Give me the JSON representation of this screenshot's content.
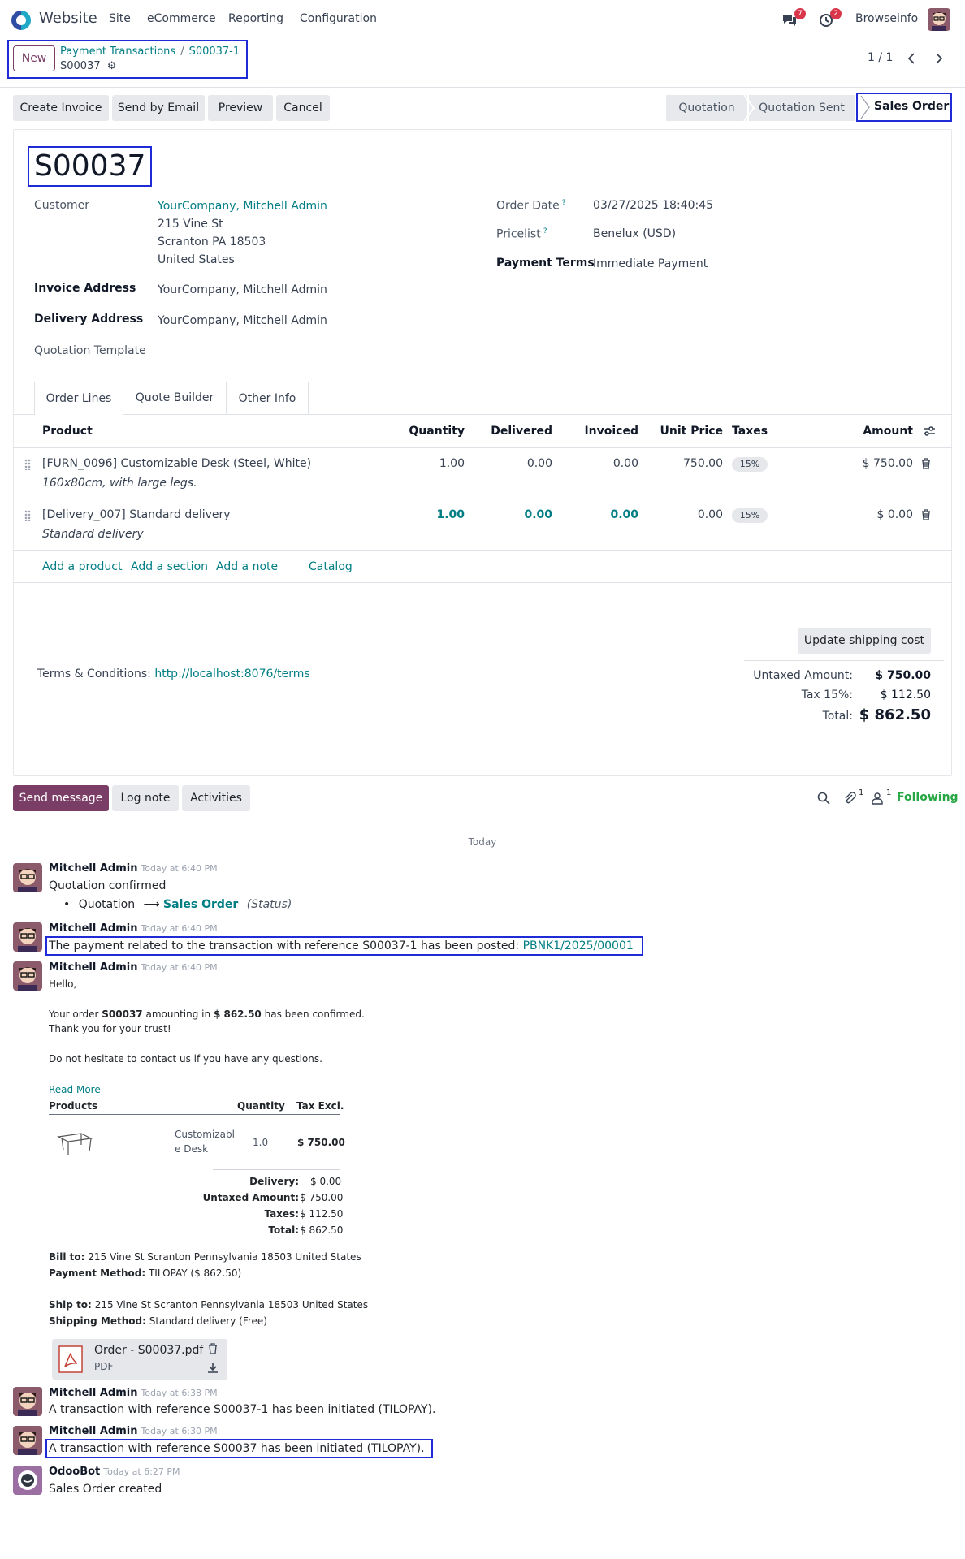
{
  "nav": {
    "app": "Website",
    "menus": [
      "Site",
      "eCommerce",
      "Reporting",
      "Configuration"
    ],
    "messages_badge": "7",
    "activities_badge": "2",
    "company": "Browseinfo"
  },
  "control": {
    "new_label": "New",
    "breadcrumb_parent": "Payment Transactions",
    "breadcrumb_current": "S00037-1",
    "record_name": "S00037",
    "pager": "1 / 1"
  },
  "actions": {
    "create_invoice": "Create Invoice",
    "send_email": "Send by Email",
    "preview": "Preview",
    "cancel": "Cancel"
  },
  "status": {
    "stages": [
      "Quotation",
      "Quotation Sent",
      "Sales Order"
    ],
    "current": "Sales Order"
  },
  "form": {
    "title": "S00037",
    "customer_label": "Customer",
    "customer_name": "YourCompany, Mitchell Admin",
    "customer_addr1": "215 Vine St",
    "customer_addr2": "Scranton PA 18503",
    "customer_addr3": "United States",
    "invoice_address_label": "Invoice Address",
    "invoice_address": "YourCompany, Mitchell Admin",
    "delivery_address_label": "Delivery Address",
    "delivery_address": "YourCompany, Mitchell Admin",
    "quotation_template_label": "Quotation Template",
    "order_date_label": "Order Date",
    "order_date": "03/27/2025 18:40:45",
    "pricelist_label": "Pricelist",
    "pricelist": "Benelux (USD)",
    "payment_terms_label": "Payment Terms",
    "payment_terms": "Immediate Payment",
    "help_mark": "?"
  },
  "tabs": [
    "Order Lines",
    "Quote Builder",
    "Other Info"
  ],
  "lines": {
    "headers": [
      "Product",
      "Quantity",
      "Delivered",
      "Invoiced",
      "Unit Price",
      "Taxes",
      "Amount"
    ],
    "rows": [
      {
        "product": "[FURN_0096] Customizable Desk (Steel, White)",
        "desc": "160x80cm, with large legs.",
        "qty": "1.00",
        "delivered": "0.00",
        "invoiced": "0.00",
        "price": "750.00",
        "tax": "15%",
        "amount": "$ 750.00"
      },
      {
        "product": "[Delivery_007] Standard delivery",
        "desc": "Standard delivery",
        "qty": "1.00",
        "delivered": "0.00",
        "invoiced": "0.00",
        "price": "0.00",
        "tax": "15%",
        "amount": "$ 0.00"
      }
    ],
    "add_product": "Add a product",
    "add_section": "Add a section",
    "add_note": "Add a note",
    "catalog": "Catalog"
  },
  "footer": {
    "update_shipping": "Update shipping cost",
    "terms_label": "Terms & Conditions:",
    "terms_link": "http://localhost:8076/terms",
    "untaxed_label": "Untaxed Amount:",
    "untaxed": "$ 750.00",
    "tax_label": "Tax 15%:",
    "tax": "$ 112.50",
    "total_label": "Total:",
    "total": "$ 862.50"
  },
  "chatter": {
    "send_message": "Send message",
    "log_note": "Log note",
    "activities": "Activities",
    "attach_count": "1",
    "follower_count": "1",
    "following": "Following",
    "today": "Today",
    "m1_author": "Mitchell Admin",
    "m1_time": "Today at 6:40 PM",
    "m1_text": "Quotation confirmed",
    "m1_from": "Quotation",
    "m1_arrow": "⟶",
    "m1_to": "Sales Order",
    "m1_field": "(Status)",
    "m2_author": "Mitchell Admin",
    "m2_time": "Today at 6:40 PM",
    "m2_text": "The payment related to the transaction with reference S00037-1 has been posted:",
    "m2_link": "PBNK1/2025/00001",
    "m3_author": "Mitchell Admin",
    "m3_time": "Today at 6:40 PM",
    "m3_hello": "Hello,",
    "m3_l1a": "Your order",
    "m3_l1b": "S00037",
    "m3_l1c": "amounting in",
    "m3_l1d": "$ 862.50",
    "m3_l1e": "has been confirmed.",
    "m3_l2": "Thank you for your trust!",
    "m3_l3": "Do not hesitate to contact us if you have any questions.",
    "m3_readmore": "Read More",
    "tbl_products": "Products",
    "tbl_qty": "Quantity",
    "tbl_tax": "Tax Excl.",
    "tbl_item1": "Customizabl",
    "tbl_item2": "e Desk",
    "tbl_item_qty": "1.0",
    "tbl_item_price": "$ 750.00",
    "delivery_label": "Delivery:",
    "delivery": "$ 0.00",
    "untaxed_label": "Untaxed Amount:",
    "untaxed": "$ 750.00",
    "taxes_label": "Taxes:",
    "taxes": "$ 112.50",
    "total_label": "Total:",
    "total": "$ 862.50",
    "bill_label": "Bill to:",
    "bill": "215 Vine St Scranton Pennsylvania 18503 United States",
    "paym_label": "Payment Method:",
    "paym": "TILOPAY ($ 862.50)",
    "ship_label": "Ship to:",
    "ship": "215 Vine St Scranton Pennsylvania 18503 United States",
    "shipm_label": "Shipping Method:",
    "shipm": "Standard delivery (Free)",
    "att_name": "Order - S00037.pdf",
    "att_type": "PDF",
    "m4_author": "Mitchell Admin",
    "m4_time": "Today at 6:38 PM",
    "m4_text": "A transaction with reference S00037-1 has been initiated (TILOPAY).",
    "m5_author": "Mitchell Admin",
    "m5_time": "Today at 6:30 PM",
    "m5_text": "A transaction with reference S00037 has been initiated (TILOPAY).",
    "m6_author": "OdooBot",
    "m6_time": "Today at 6:27 PM",
    "m6_text": "Sales Order created"
  }
}
